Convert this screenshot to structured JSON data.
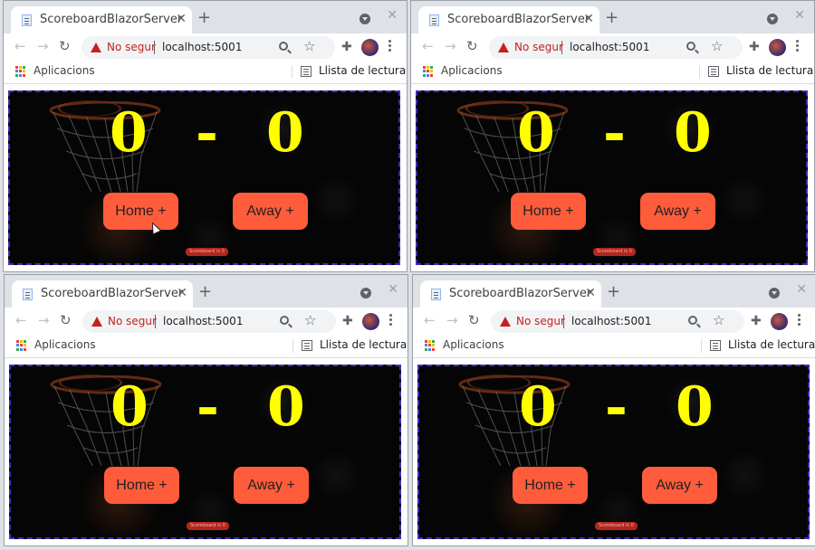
{
  "windows": [
    {
      "tab_title": "ScoreboardBlazorServer",
      "security_label": "No segur",
      "url": "localhost:5001",
      "bookmarks_label": "Aplicacions",
      "reading_list_label": "Llista de lectura",
      "home_score": "0",
      "separator": "-",
      "away_score": "0",
      "home_button": "Home +",
      "away_button": "Away +",
      "footer_badge": "Scoreboard is 0"
    },
    {
      "tab_title": "ScoreboardBlazorServer",
      "security_label": "No segur",
      "url": "localhost:5001",
      "bookmarks_label": "Aplicacions",
      "reading_list_label": "Llista de lectura",
      "home_score": "0",
      "separator": "-",
      "away_score": "0",
      "home_button": "Home +",
      "away_button": "Away +",
      "footer_badge": "Scoreboard is 0"
    },
    {
      "tab_title": "ScoreboardBlazorServer",
      "security_label": "No segur",
      "url": "localhost:5001",
      "bookmarks_label": "Aplicacions",
      "reading_list_label": "Llista de lectura",
      "home_score": "0",
      "separator": "-",
      "away_score": "0",
      "home_button": "Home +",
      "away_button": "Away +",
      "footer_badge": "Scoreboard is 0"
    },
    {
      "tab_title": "ScoreboardBlazorServer",
      "security_label": "No segur",
      "url": "localhost:5001",
      "bookmarks_label": "Aplicacions",
      "reading_list_label": "Llista de lectura",
      "home_score": "0",
      "separator": "-",
      "away_score": "0",
      "home_button": "Home +",
      "away_button": "Away +",
      "footer_badge": "Scoreboard is 0"
    }
  ],
  "icons": {
    "close": "close-icon",
    "new_tab": "plus-icon",
    "back": "arrow-left-icon",
    "forward": "arrow-right-icon",
    "reload": "reload-icon",
    "warning": "warning-icon",
    "zoom": "magnifier-icon",
    "star": "star-icon",
    "extensions": "puzzle-icon",
    "menu": "kebab-menu-icon",
    "apps": "apps-grid-icon",
    "reading_list": "reading-list-icon"
  },
  "colors": {
    "score": "#ffff00",
    "button_bg": "#ff5c3c",
    "border": "#3b2ec0",
    "insecure": "#c5221f",
    "background": "#050505"
  }
}
